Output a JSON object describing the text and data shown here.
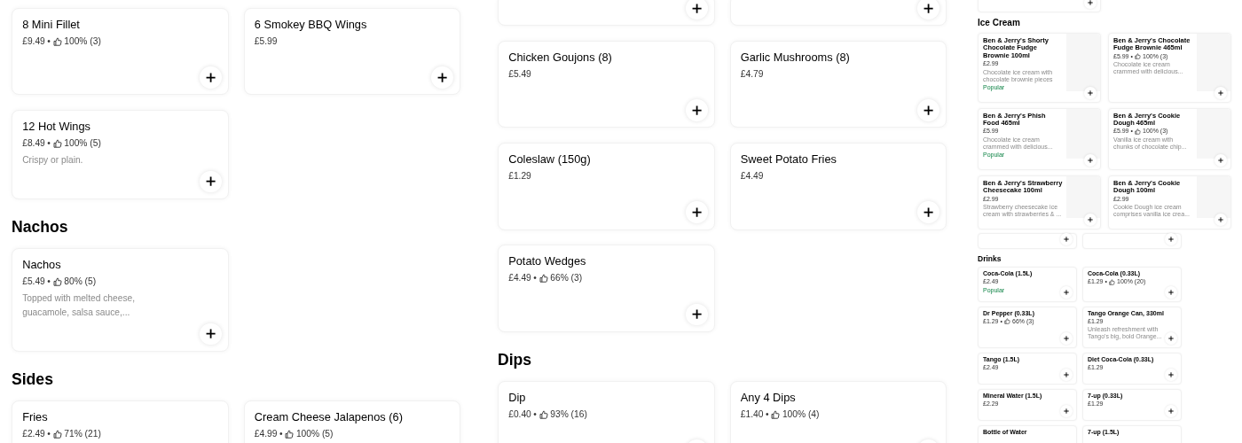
{
  "panels": [
    {
      "sections": [
        {
          "items": [
            {
              "kind": "item",
              "name": "8 Mini Fillet",
              "price": "£9.49",
              "rating": {
                "separator": "•",
                "text": "100% (3)"
              }
            },
            {
              "kind": "item",
              "name": "6 Smokey BBQ Wings",
              "price": "£5.99"
            },
            {
              "kind": "item",
              "name": "12 Hot Wings",
              "price": "£8.49",
              "rating": {
                "separator": "•",
                "text": "100% (5)"
              },
              "description": "Crispy or plain."
            }
          ]
        },
        {
          "title": "Nachos",
          "items": [
            {
              "kind": "item",
              "name": "Nachos",
              "price": "£5.49",
              "rating": {
                "separator": "•",
                "text": "80% (5)"
              },
              "description": "Topped with melted cheese, guacamole, salsa sauce,..."
            }
          ]
        },
        {
          "title": "Sides",
          "items": [
            {
              "kind": "item",
              "name": "Fries",
              "price": "£2.49",
              "rating": {
                "separator": "•",
                "text": "71% (21)"
              }
            },
            {
              "kind": "item",
              "name": "Cream Cheese Jalapenos (6)",
              "price": "£4.99",
              "rating": {
                "separator": "•",
                "text": "100% (5)"
              }
            }
          ]
        }
      ]
    },
    {
      "sections": [
        {
          "items": [
            {
              "kind": "stub"
            },
            {
              "kind": "stub"
            },
            {
              "kind": "item",
              "name": "Chicken Goujons (8)",
              "price": "£5.49"
            },
            {
              "kind": "item",
              "name": "Garlic Mushrooms (8)",
              "price": "£4.79"
            },
            {
              "kind": "item",
              "name": "Coleslaw (150g)",
              "price": "£1.29"
            },
            {
              "kind": "item",
              "name": "Sweet Potato Fries",
              "price": "£4.49"
            },
            {
              "kind": "item",
              "name": "Potato Wedges",
              "price": "£4.49",
              "rating": {
                "separator": "•",
                "text": "66% (3)"
              }
            }
          ]
        },
        {
          "title": "Dips",
          "items": [
            {
              "kind": "item",
              "name": "Dip",
              "price": "£0.40",
              "rating": {
                "separator": "•",
                "text": "93% (16)"
              }
            },
            {
              "kind": "item",
              "name": "Any 4 Dips",
              "price": "£1.40",
              "rating": {
                "separator": "•",
                "text": "100% (4)"
              }
            }
          ]
        }
      ]
    },
    {
      "sections": [
        {
          "items": [
            {
              "kind": "stub"
            }
          ]
        },
        {
          "title": "Ice Cream",
          "items": [
            {
              "kind": "item",
              "image": true,
              "name": "Ben & Jerry's Shorty Chocolate Fudge Brownie 100ml",
              "price": "£2.99",
              "description": "Chocolate ice cream with chocolate brownie pieces",
              "tag": "Popular"
            },
            {
              "kind": "item",
              "image": true,
              "name": "Ben & Jerry's Chocolate Fudge Brownie 465ml",
              "price": "£5.99",
              "rating": {
                "separator": "•",
                "text": "100% (3)"
              },
              "description": "Chocolate ice cream crammed with delicious..."
            },
            {
              "kind": "item",
              "image": true,
              "name": "Ben & Jerry's Phish Food 465ml",
              "price": "£5.99",
              "description": "Chocolate ice cream crammed with delicious...",
              "tag": "Popular"
            },
            {
              "kind": "item",
              "image": true,
              "name": "Ben & Jerry's Cookie Dough 465ml",
              "price": "£5.99",
              "rating": {
                "separator": "•",
                "text": "100% (3)"
              },
              "description": "Vanilla ice cream with chunks of chocolate chip..."
            },
            {
              "kind": "item",
              "image": true,
              "name": "Ben & Jerry's Strawberry Cheesecake 100ml",
              "price": "£2.99",
              "description": "Strawberry cheesecake ice cream with strawberries & ..."
            },
            {
              "kind": "item",
              "image": true,
              "name": "Ben & Jerry's Cookie Dough 100ml",
              "price": "£2.99",
              "description": "Cookie Dough ice cream comprises vanilla ice crea..."
            }
          ]
        },
        {
          "compact": true,
          "items": [
            {
              "kind": "stub"
            },
            {
              "kind": "stub"
            }
          ]
        },
        {
          "compact": true,
          "title": "Drinks",
          "items": [
            {
              "kind": "item",
              "name": "Coca-Cola (1.5L)",
              "price": "£2.49",
              "tag": "Popular"
            },
            {
              "kind": "item",
              "name": "Coca-Cola (0.33L)",
              "price": "£1.29",
              "rating": {
                "separator": "•",
                "text": "100% (20)"
              }
            },
            {
              "kind": "item",
              "name": "Dr Pepper (0.33L)",
              "price": "£1.29",
              "rating": {
                "separator": "•",
                "text": "66% (3)"
              }
            },
            {
              "kind": "item",
              "name": "Tango Orange Can, 330ml",
              "price": "£1.29",
              "description": "Unleash refreshment with Tango's big, bold Orange..."
            },
            {
              "kind": "item",
              "name": "Tango (1.5L)",
              "price": "£2.49"
            },
            {
              "kind": "item",
              "name": "Diet Coca-Cola (0.33L)",
              "price": "£1.29"
            },
            {
              "kind": "item",
              "name": "Mineral Water (1.5L)",
              "price": "£2.29"
            },
            {
              "kind": "item",
              "name": "7-up (0.33L)",
              "price": "£1.29"
            },
            {
              "kind": "cut_item",
              "name": "Bottle of Water"
            },
            {
              "kind": "cut_item",
              "name": "7-up (1.5L)"
            }
          ]
        }
      ]
    }
  ]
}
